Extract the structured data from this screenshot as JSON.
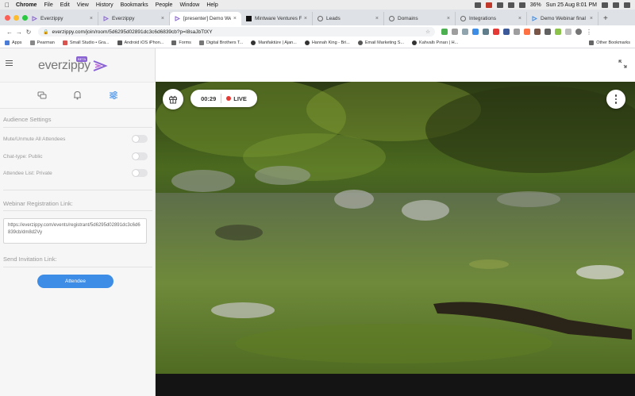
{
  "menubar": {
    "app": "Chrome",
    "items": [
      "File",
      "Edit",
      "View",
      "History",
      "Bookmarks",
      "People",
      "Window",
      "Help"
    ],
    "battery": "36%",
    "clock": "Sun 25 Aug  8:01 PM"
  },
  "tabs": [
    {
      "title": "Everzippy",
      "color": "#8a63d2"
    },
    {
      "title": "Everzippy",
      "color": "#8a63d2"
    },
    {
      "title": "[presenter] Demo Webi",
      "color": "#8a63d2",
      "active": true
    },
    {
      "title": "Mintware Ventures FZ",
      "color": "#111111"
    },
    {
      "title": "Leads",
      "color": "#666666"
    },
    {
      "title": "Domains",
      "color": "#666666"
    },
    {
      "title": "Integrations",
      "color": "#666666"
    },
    {
      "title": "Demo Webinar final",
      "color": "#3d8de6"
    }
  ],
  "toolbar": {
    "url": "everzippy.com/join/room/5d6295d02891dc3c6d6839cb?p=I8saJbTtXY"
  },
  "bookmarks": [
    {
      "label": "Apps",
      "color": "#4a7bd6"
    },
    {
      "label": "Pearman",
      "color": "#888888"
    },
    {
      "label": "Small Studio • Gra...",
      "color": "#d9534f"
    },
    {
      "label": "Android iOS iPhon...",
      "color": "#555555"
    },
    {
      "label": "Forms",
      "color": "#666666"
    },
    {
      "label": "Digital Brothers T...",
      "color": "#777777"
    },
    {
      "label": "Manifaktüre | Ajan...",
      "color": "#333333"
    },
    {
      "label": "Hannah King - Bri...",
      "color": "#333333"
    },
    {
      "label": "Email Marketing S...",
      "color": "#555555"
    },
    {
      "label": "Kahvaltı Pınarı | H...",
      "color": "#333333"
    }
  ],
  "bookmarks_other": "Other Bookmarks",
  "sidebar": {
    "logo": "everzippy",
    "logo_badge": "BETA",
    "audience_title": "Audience Settings",
    "settings": [
      {
        "label": "Mute/Unmute All Attendees",
        "on": false
      },
      {
        "label": "Chat-type: Public",
        "on": false
      },
      {
        "label": "Attendee List: Private",
        "on": false
      }
    ],
    "registration_title": "Webinar Registration Link:",
    "registration_link": "https://everzippy.com/events/registrant/5d6295d02891dc3c6d6839cb/dm8d2Vy",
    "invite_title": "Send Invitation Link:",
    "invite_button": "Attendee"
  },
  "stage": {
    "timer": "00:29",
    "live_label": "LIVE"
  },
  "colors": {
    "accent": "#3d8de6",
    "brand": "#8a63d2",
    "live": "#e53935"
  }
}
